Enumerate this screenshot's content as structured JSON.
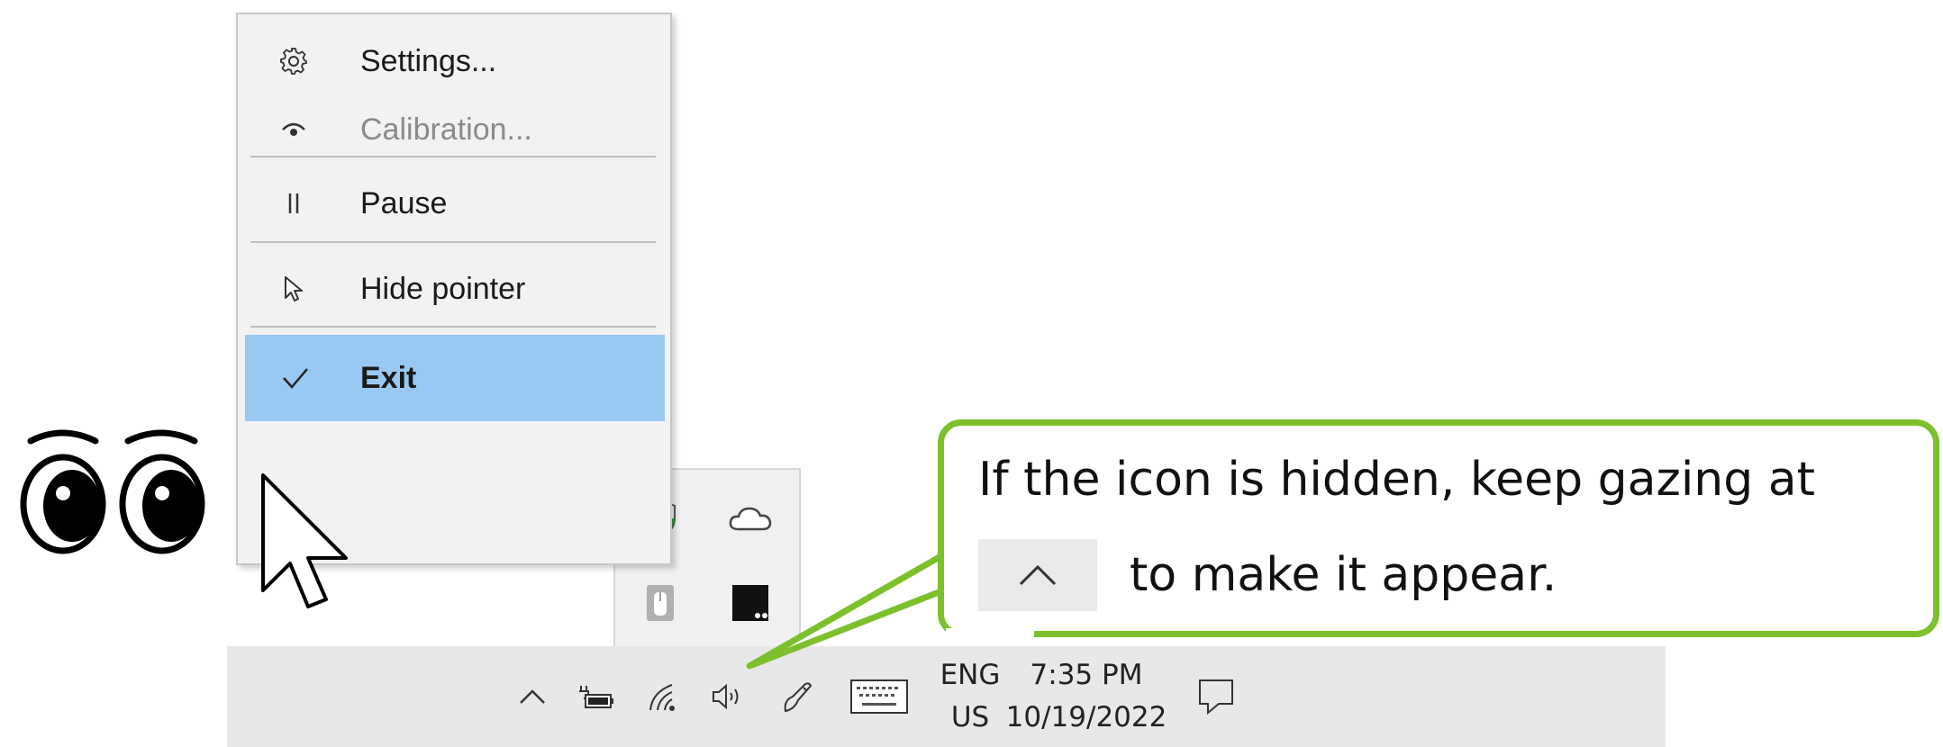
{
  "menu": {
    "items": [
      {
        "label": "Settings...",
        "icon": "gear-icon",
        "state": "normal"
      },
      {
        "label": "Calibration...",
        "icon": "eye-icon",
        "state": "disabled"
      },
      {
        "label": "Pause",
        "icon": "pause-icon",
        "state": "normal"
      },
      {
        "label": "Hide pointer",
        "icon": "pointer-icon",
        "state": "normal"
      },
      {
        "label": "Exit",
        "icon": "checkmark-icon",
        "state": "highlighted"
      }
    ]
  },
  "tray_overflow": {
    "icons": [
      "windows-security-icon",
      "onedrive-icon",
      "usb-device-icon",
      "app-icon"
    ]
  },
  "taskbar": {
    "icons": [
      "chevron-up-icon",
      "battery-icon",
      "wifi-icon",
      "volume-icon",
      "pen-icon",
      "keyboard-icon",
      "action-center-icon"
    ],
    "language_line1": "ENG",
    "language_line2": "US",
    "time": "7:35 PM",
    "date": "10/19/2022"
  },
  "callout": {
    "line1": "If the icon is hidden, keep gazing at",
    "line2": "to make it appear.",
    "border_color": "#7cc12c"
  },
  "colors": {
    "menu_highlight": "#99c9f2",
    "taskbar_bg": "#e8e8e8",
    "callout_border": "#7cc12c"
  }
}
